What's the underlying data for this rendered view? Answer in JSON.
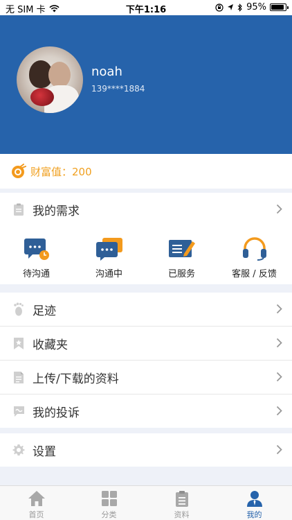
{
  "status_bar": {
    "carrier": "无 SIM 卡",
    "time": "下午1:16",
    "battery": "95%",
    "battery_level": 0.95
  },
  "profile": {
    "name": "noah",
    "phone": "139****1884"
  },
  "wealth": {
    "label": "财富值：200"
  },
  "menu": {
    "requirements": "我的需求",
    "footprint": "足迹",
    "favorites": "收藏夹",
    "materials": "上传/下载的资料",
    "complaints": "我的投诉",
    "settings": "设置"
  },
  "services": [
    {
      "label": "待沟通",
      "icon": "pending-chat-icon"
    },
    {
      "label": "沟通中",
      "icon": "chatting-icon"
    },
    {
      "label": "已服务",
      "icon": "served-icon"
    },
    {
      "label": "客服 / 反馈",
      "icon": "headset-icon"
    }
  ],
  "tabs": [
    {
      "label": "首页",
      "icon": "home-icon"
    },
    {
      "label": "分类",
      "icon": "category-icon"
    },
    {
      "label": "资料",
      "icon": "document-icon"
    },
    {
      "label": "我的",
      "icon": "profile-icon",
      "active": true
    }
  ],
  "colors": {
    "brand_blue": "#2663ab",
    "wealth_orange": "#f0a020",
    "icon_blue": "#2f5f97",
    "icon_orange": "#f39a1d"
  }
}
